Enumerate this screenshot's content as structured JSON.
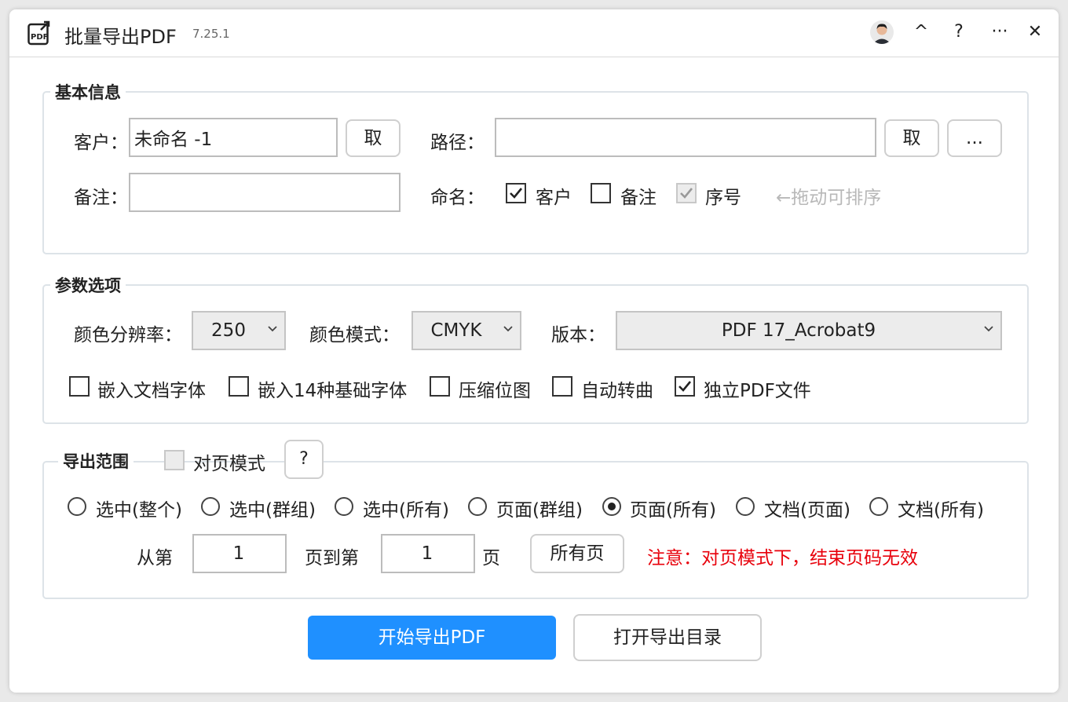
{
  "titlebar": {
    "app_icon": "pdf-export-icon",
    "title": "批量导出PDF",
    "version": "7.25.1",
    "buttons": {
      "collapse": "^",
      "help": "?",
      "more": "···",
      "close": "✕"
    }
  },
  "basic_info": {
    "title": "基本信息",
    "customer_label": "客户：",
    "customer_value": "未命名 -1",
    "customer_pick": "取",
    "path_label": "路径：",
    "path_value": "",
    "path_pick": "取",
    "path_browse": "...",
    "remark_label": "备注：",
    "remark_value": "",
    "naming_label": "命名：",
    "naming_options": [
      {
        "label": "客户",
        "checked": true,
        "disabled": false
      },
      {
        "label": "备注",
        "checked": false,
        "disabled": false
      },
      {
        "label": "序号",
        "checked": true,
        "disabled": true
      }
    ],
    "drag_hint": "←拖动可排序"
  },
  "params": {
    "title": "参数选项",
    "resolution_label": "颜色分辨率：",
    "resolution_value": "250",
    "color_mode_label": "颜色模式：",
    "color_mode_value": "CMYK",
    "version_label": "版本：",
    "version_value": "PDF 17_Acrobat9",
    "options": [
      {
        "label": "嵌入文档字体",
        "checked": false
      },
      {
        "label": "嵌入14种基础字体",
        "checked": false
      },
      {
        "label": "压缩位图",
        "checked": false
      },
      {
        "label": "自动转曲",
        "checked": false
      },
      {
        "label": "独立PDF文件",
        "checked": true
      }
    ]
  },
  "range": {
    "title": "导出范围",
    "facing_label": "对页模式",
    "facing_checked": false,
    "help": "?",
    "radios": [
      {
        "label": "选中(整个)",
        "selected": false
      },
      {
        "label": "选中(群组)",
        "selected": false
      },
      {
        "label": "选中(所有)",
        "selected": false
      },
      {
        "label": "页面(群组)",
        "selected": false
      },
      {
        "label": "页面(所有)",
        "selected": true
      },
      {
        "label": "文档(页面)",
        "selected": false
      },
      {
        "label": "文档(所有)",
        "selected": false
      }
    ],
    "from_label": "从第",
    "from_value": "1",
    "to_label": "页到第",
    "to_value": "1",
    "page_label": "页",
    "all_pages": "所有页",
    "note": "注意：对页模式下，结束页码无效",
    "note_color": "#e8000b"
  },
  "actions": {
    "start": "开始导出PDF",
    "open_dir": "打开导出目录"
  }
}
